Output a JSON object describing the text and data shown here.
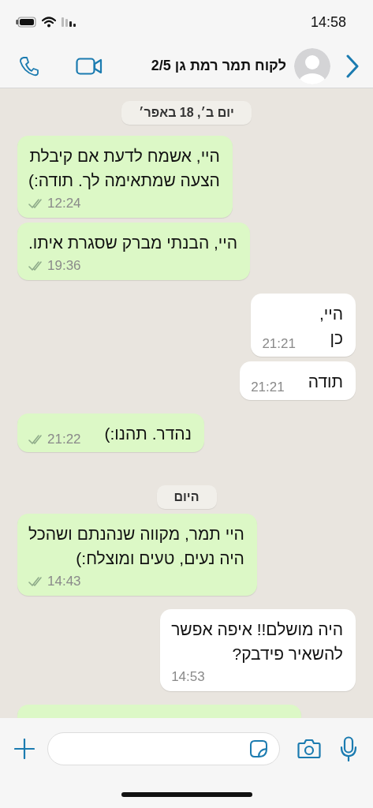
{
  "status_bar": {
    "time": "14:58"
  },
  "header": {
    "contact_name": "לקוח תמר רמת גן 2/5"
  },
  "chat": [
    {
      "kind": "date",
      "label": "יום ב׳, 18 באפר׳"
    },
    {
      "kind": "sent",
      "lines": [
        "היי, אשמח לדעת אם קיבלת",
        "הצעה שמתאימה לך. תודה:)"
      ],
      "time": "12:24",
      "read": false
    },
    {
      "kind": "sent",
      "lines": [
        "היי, הבנתי מברק שסגרת איתו."
      ],
      "time": "19:36",
      "read": false
    },
    {
      "kind": "received",
      "lines": [
        "היי,",
        "כן"
      ],
      "time": "21:21"
    },
    {
      "kind": "received",
      "lines": [
        "תודה"
      ],
      "time": "21:21"
    },
    {
      "kind": "sent",
      "lines": [
        "נהדר. תהנו:)"
      ],
      "time": "21:22",
      "read": false
    },
    {
      "kind": "date",
      "label": "היום"
    },
    {
      "kind": "sent",
      "lines": [
        "היי תמר, מקווה שנהנתם ושהכל",
        "היה נעים, טעים ומוצלח:)"
      ],
      "time": "14:43",
      "read": false
    },
    {
      "kind": "received",
      "lines": [
        "היה מושלם!! איפה אפשר",
        "להשאיר פידבק?"
      ],
      "time": "14:53"
    }
  ]
}
